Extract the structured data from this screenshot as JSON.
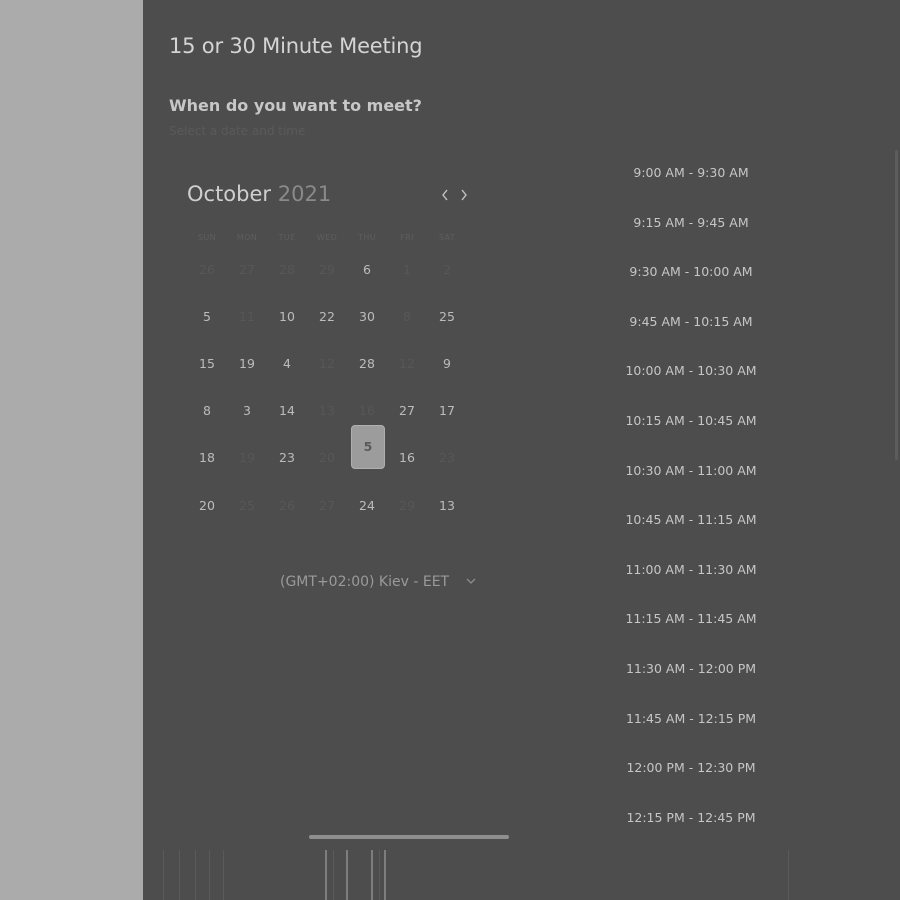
{
  "meeting": {
    "title": "15 or 30 Minute Meeting",
    "question": "When do you want to meet?",
    "hint": "Select a date and time"
  },
  "calendar": {
    "month": "October",
    "year": "2021",
    "weekdays": [
      "SUN",
      "MON",
      "TUE",
      "WED",
      "THU",
      "FRI",
      "SAT"
    ],
    "rows": [
      [
        {
          "d": "26",
          "s": "off"
        },
        {
          "d": "27",
          "s": "off"
        },
        {
          "d": "28",
          "s": "off"
        },
        {
          "d": "29",
          "s": "off"
        },
        {
          "d": "6",
          "s": "on"
        },
        {
          "d": "1",
          "s": "off"
        },
        {
          "d": "2",
          "s": "off"
        }
      ],
      [
        {
          "d": "5",
          "s": "on"
        },
        {
          "d": "11",
          "s": "off"
        },
        {
          "d": "10",
          "s": "on"
        },
        {
          "d": "22",
          "s": "on"
        },
        {
          "d": "30",
          "s": "on"
        },
        {
          "d": "8",
          "s": "off"
        },
        {
          "d": "25",
          "s": "on"
        }
      ],
      [
        {
          "d": "15",
          "s": "on"
        },
        {
          "d": "19",
          "s": "on"
        },
        {
          "d": "4",
          "s": "on"
        },
        {
          "d": "12",
          "s": "off"
        },
        {
          "d": "28",
          "s": "on"
        },
        {
          "d": "12",
          "s": "off"
        },
        {
          "d": "9",
          "s": "on"
        }
      ],
      [
        {
          "d": "8",
          "s": "on"
        },
        {
          "d": "3",
          "s": "on"
        },
        {
          "d": "14",
          "s": "on"
        },
        {
          "d": "13",
          "s": "off"
        },
        {
          "d": "16",
          "s": "off"
        },
        {
          "d": "27",
          "s": "on"
        },
        {
          "d": "17",
          "s": "on"
        }
      ],
      [
        {
          "d": "18",
          "s": "on"
        },
        {
          "d": "19",
          "s": "off"
        },
        {
          "d": "23",
          "s": "on"
        },
        {
          "d": "20",
          "s": "off"
        },
        {
          "d": "5",
          "s": "selected"
        },
        {
          "d": "16",
          "s": "on"
        },
        {
          "d": "23",
          "s": "off"
        }
      ],
      [
        {
          "d": "20",
          "s": "on"
        },
        {
          "d": "25",
          "s": "off"
        },
        {
          "d": "26",
          "s": "off"
        },
        {
          "d": "27",
          "s": "off"
        },
        {
          "d": "24",
          "s": "on"
        },
        {
          "d": "29",
          "s": "off"
        },
        {
          "d": "13",
          "s": "on"
        }
      ]
    ],
    "prev_icon": "chevron-left-icon",
    "next_icon": "chevron-right-icon"
  },
  "timezone": {
    "label": "(GMT+02:00) Kiev - EET",
    "icon": "chevron-down-icon"
  },
  "slots": [
    "9:00 AM - 9:30 AM",
    "9:15 AM - 9:45 AM",
    "9:30 AM - 10:00 AM",
    "9:45 AM - 10:15 AM",
    "10:00 AM - 10:30 AM",
    "10:15 AM - 10:45 AM",
    "10:30 AM - 11:00 AM",
    "10:45 AM - 11:15 AM",
    "11:00 AM - 11:30 AM",
    "11:15 AM - 11:45 AM",
    "11:30 AM - 12:00 PM",
    "11:45 AM - 12:15 PM",
    "12:00 PM - 12:30 PM",
    "12:15 PM - 12:45 PM"
  ],
  "colors": {
    "backdrop": "#ababab",
    "panel": "#4d4d4d",
    "selected_day": "#9c9c9c"
  }
}
